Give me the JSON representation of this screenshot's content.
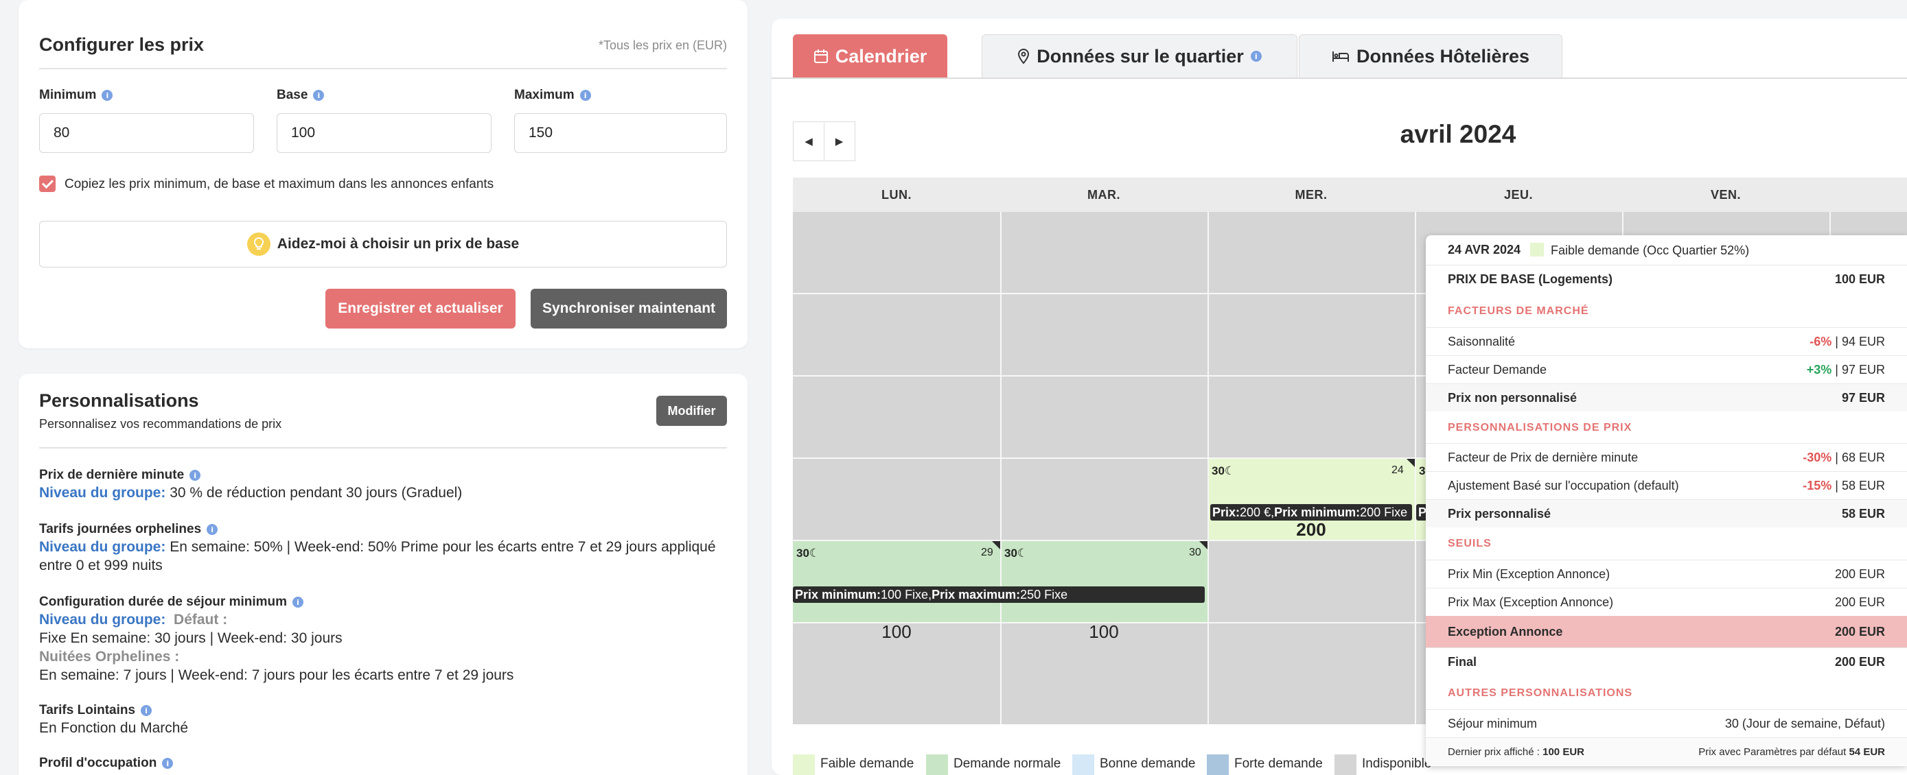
{
  "config": {
    "title": "Configurer les prix",
    "currency_note": "*Tous les prix en (EUR)",
    "minimum": {
      "label": "Minimum",
      "value": "80"
    },
    "base": {
      "label": "Base",
      "value": "100"
    },
    "maximum": {
      "label": "Maximum",
      "value": "150"
    },
    "copy_checkbox_label": "Copiez les prix minimum, de base et maximum dans les annonces enfants",
    "help_button": "Aidez-moi à choisir un prix de base",
    "save_button": "Enregistrer et actualiser",
    "sync_button": "Synchroniser maintenant"
  },
  "perso": {
    "title": "Personnalisations",
    "subtitle": "Personnalisez vos recommandations de prix",
    "modify_button": "Modifier",
    "last_minute": {
      "title": "Prix de dernière minute",
      "group": "Niveau du groupe:",
      "text": " 30 % de réduction pendant 30 jours (Graduel)"
    },
    "orphan": {
      "title": "Tarifs journées orphelines",
      "group": "Niveau du groupe:",
      "text": " En semaine: 50% | Week-end: 50% Prime pour les écarts entre 7 et 29 jours appliqué",
      "text2": "entre 0 et 999 nuits"
    },
    "min_stay": {
      "title": "Configuration durée de séjour minimum",
      "group": "Niveau du groupe:",
      "default": "Défaut :",
      "line1": "Fixe En semaine: 30 jours | Week-end: 30 jours",
      "orphan_label": "Nuitées Orphelines :",
      "line2": "En semaine: 7 jours | Week-end: 7 jours pour les écarts entre 7 et 29 jours"
    },
    "far": {
      "title": "Tarifs Lointains",
      "text": "En Fonction du Marché"
    },
    "occupancy": {
      "title": "Profil d'occupation"
    }
  },
  "calendar": {
    "tabs": {
      "calendar": "Calendrier",
      "neighborhood": "Données sur le quartier",
      "hotel": "Données Hôtelières"
    },
    "month": "avril 2024",
    "days": [
      "LUN.",
      "MAR.",
      "MER.",
      "JEU.",
      "VEN."
    ],
    "cells": {
      "mon29": {
        "stay": "30☾",
        "date": "29",
        "price": "100"
      },
      "tue30": {
        "stay": "30☾",
        "date": "30",
        "price": "100"
      },
      "wed24": {
        "stay": "30☾",
        "date": "24",
        "price": "200",
        "thu_partial": "3"
      },
      "thu_bar_partial": "P"
    },
    "bar_wed": {
      "l1": "Prix:",
      "v1": " 200 €, ",
      "l2": "Prix minimum:",
      "v2": " 200 Fixe"
    },
    "bar_week": {
      "l1": "Prix minimum:",
      "v1": " 100 Fixe, ",
      "l2": "Prix maximum:",
      "v2": " 250 Fixe"
    },
    "legend": [
      {
        "label": "Faible demande",
        "color": "#e6f6cf"
      },
      {
        "label": "Demande normale",
        "color": "#c8e6c5"
      },
      {
        "label": "Bonne demande",
        "color": "#d4e8f7"
      },
      {
        "label": "Forte demande",
        "color": "#a9c4dd"
      },
      {
        "label": "Indisponible",
        "color": "#d5d5d5"
      }
    ]
  },
  "popup": {
    "date": "24 AVR 2024",
    "demand": "Faible demande (Occ Quartier 52%)",
    "base_label": "PRIX DE BASE (Logements)",
    "base_value": "100 EUR",
    "h_market": "FACTEURS DE MARCHÉ",
    "season_label": "Saisonnalité",
    "season_pct": "-6%",
    "season_val": " | 94 EUR",
    "demand_label": "Facteur Demande",
    "demand_pct": "+3%",
    "demand_val": " | 97 EUR",
    "unpers_label": "Prix non personnalisé",
    "unpers_value": "97 EUR",
    "h_perso": "PERSONNALISATIONS DE PRIX",
    "lastmin_label": "Facteur de Prix de dernière minute",
    "lastmin_pct": "-30%",
    "lastmin_val": " | 68 EUR",
    "occ_label": "Ajustement Basé sur l'occupation (default)",
    "occ_pct": "-15%",
    "occ_val": " | 58 EUR",
    "pers_label": "Prix personnalisé",
    "pers_value": "58 EUR",
    "h_seuils": "SEUILS",
    "min_label": "Prix Min (Exception Annonce)",
    "min_value": "200 EUR",
    "max_label": "Prix Max (Exception Annonce)",
    "max_value": "200 EUR",
    "exc_label": "Exception Annonce",
    "exc_value": "200 EUR",
    "final_label": "Final",
    "final_value": "200 EUR",
    "h_other": "AUTRES PERSONNALISATIONS",
    "stay_label": "Séjour minimum",
    "stay_value": "30 (Jour de semaine, Défaut)",
    "last_shown_label": "Dernier prix affiché : ",
    "last_shown_value": "100 EUR",
    "default_label": "Prix avec Paramètres par défaut ",
    "default_value": "54 EUR"
  },
  "colors": {
    "accent": "#e57373",
    "dark_button": "#616161",
    "info": "#7aa2e3"
  }
}
